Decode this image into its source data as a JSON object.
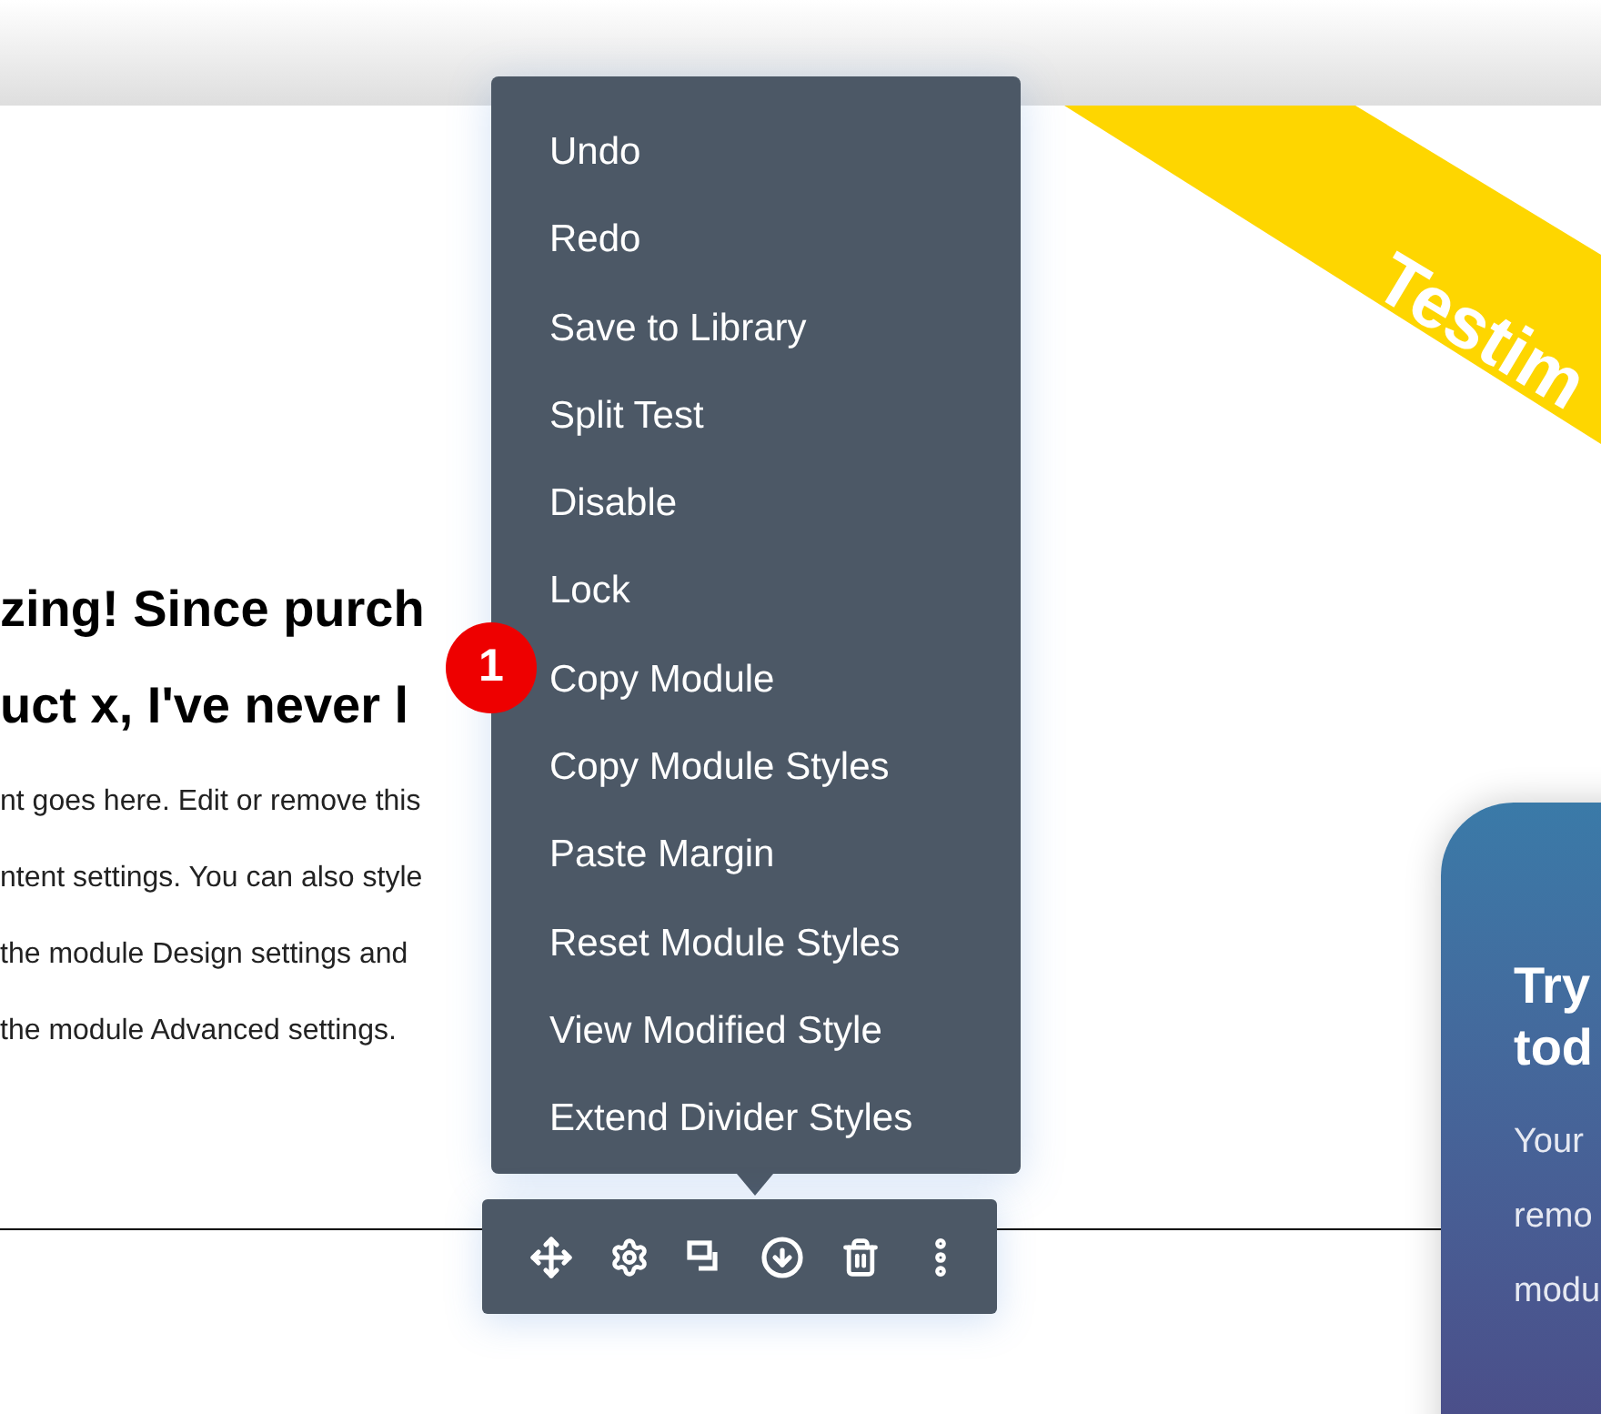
{
  "ribbon": {
    "label": "Testim"
  },
  "heading_lines": [
    "zing! Since purch",
    "uct x, I've never l"
  ],
  "body_lines": [
    "nt goes here. Edit or remove this",
    "ntent settings. You can also style",
    "the module Design settings and",
    "the module Advanced settings."
  ],
  "context_menu": {
    "items": [
      {
        "label": "Undo"
      },
      {
        "label": "Redo"
      },
      {
        "label": "Save to Library"
      },
      {
        "label": "Split Test"
      },
      {
        "label": "Disable"
      },
      {
        "label": "Lock"
      },
      {
        "label": "Copy Module"
      },
      {
        "label": "Copy Module Styles"
      },
      {
        "label": "Paste Margin"
      },
      {
        "label": "Reset Module Styles"
      },
      {
        "label": "View Modified Style"
      },
      {
        "label": "Extend Divider Styles"
      }
    ]
  },
  "step_badge": "1",
  "card": {
    "title_lines": [
      "Try",
      "tod"
    ],
    "body_lines": [
      "Your",
      "remo",
      "modu"
    ]
  }
}
